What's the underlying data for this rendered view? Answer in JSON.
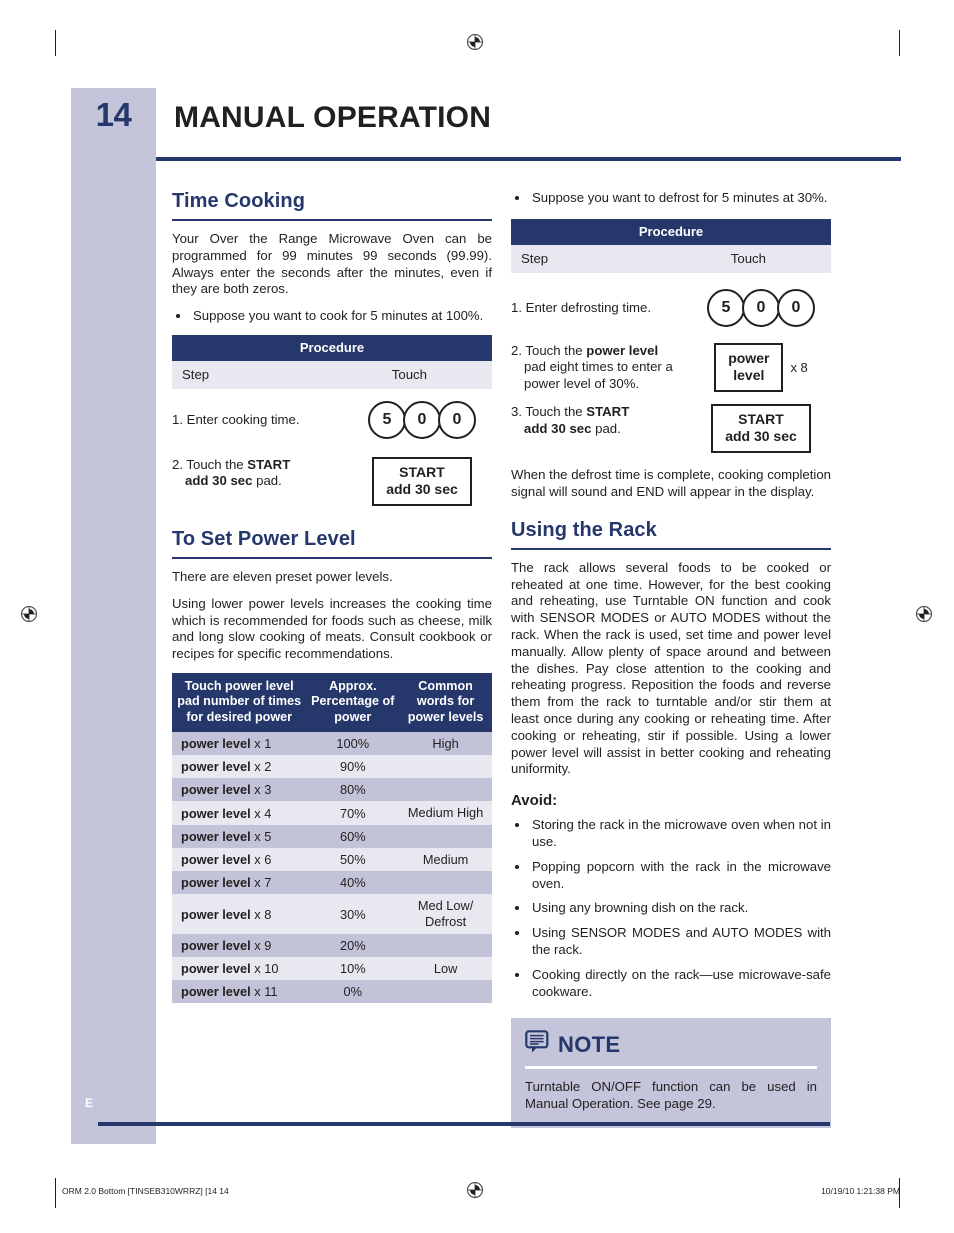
{
  "masthead": {
    "page_number": "14",
    "title": "MANUAL OPERATION"
  },
  "left_column": {
    "time_cooking": {
      "heading": "Time Cooking",
      "intro": "Your Over the Range Microwave Oven can be programmed for 99 minutes 99 seconds (99.99). Always enter the seconds after the minutes, even if they are both zeros.",
      "bullet": "Suppose you want to cook for 5 minutes at 100%.",
      "table": {
        "header": "Procedure",
        "col_step": "Step",
        "col_touch": "Touch",
        "rows": [
          {
            "step_plain": "1. Enter cooking time.",
            "touch_type": "keys",
            "keys": [
              "5",
              "0",
              "0"
            ]
          },
          {
            "step_prefix": "2. Touch the ",
            "step_bold": "START",
            "step_bold2": "add 30 sec",
            "step_suffix": " pad.",
            "touch_type": "pad",
            "pad_line1": "START",
            "pad_line2": "add 30 sec"
          }
        ]
      }
    },
    "power_level": {
      "heading": "To Set Power Level",
      "para1": "There are eleven preset power levels.",
      "para2": "Using lower power levels increases the cooking time which is recommended for foods such as cheese, milk and long slow cooking of meats. Consult cookbook or recipes for specific recommendations.",
      "table": {
        "headers": [
          "Touch power level pad number of times for desired power",
          "Approx. Percentage of power",
          "Common words for power levels"
        ],
        "rows": [
          {
            "pad_bold": "power level",
            "times": "x 1",
            "percent": "100%",
            "word": "High"
          },
          {
            "pad_bold": "power level",
            "times": "x 2",
            "percent": "90%",
            "word": ""
          },
          {
            "pad_bold": "power level",
            "times": "x 3",
            "percent": "80%",
            "word": ""
          },
          {
            "pad_bold": "power level",
            "times": "x 4",
            "percent": "70%",
            "word": "Medium High"
          },
          {
            "pad_bold": "power level",
            "times": "x 5",
            "percent": "60%",
            "word": ""
          },
          {
            "pad_bold": "power level",
            "times": "x 6",
            "percent": "50%",
            "word": "Medium"
          },
          {
            "pad_bold": "power level",
            "times": "x 7",
            "percent": "40%",
            "word": ""
          },
          {
            "pad_bold": "power level",
            "times": "x 8",
            "percent": "30%",
            "word": "Med Low/ Defrost"
          },
          {
            "pad_bold": "power level",
            "times": "x 9",
            "percent": "20%",
            "word": ""
          },
          {
            "pad_bold": "power level",
            "times": "x 10",
            "percent": "10%",
            "word": "Low"
          },
          {
            "pad_bold": "power level",
            "times": "x 11",
            "percent": "0%",
            "word": ""
          }
        ]
      }
    }
  },
  "right_column": {
    "defrost": {
      "bullet": "Suppose you want to defrost for 5 minutes at 30%.",
      "table": {
        "header": "Procedure",
        "col_step": "Step",
        "col_touch": "Touch",
        "rows": [
          {
            "step_plain": "1. Enter defrosting time.",
            "touch_type": "keys",
            "keys": [
              "5",
              "0",
              "0"
            ]
          },
          {
            "step_prefix": "2. Touch the ",
            "step_bold": "power level",
            "step_suffix": " pad eight times to enter a power level of 30%.",
            "touch_type": "pad",
            "pad_line1": "power",
            "pad_line2": "level",
            "multiplier": "x 8"
          },
          {
            "step_prefix": "3. Touch the ",
            "step_bold": "START",
            "step_bold2": "add 30 sec",
            "step_suffix": " pad.",
            "touch_type": "pad",
            "pad_line1": "START",
            "pad_line2": "add 30 sec"
          }
        ]
      },
      "closing": "When the defrost time is complete, cooking completion signal will sound and END will appear in the display."
    },
    "using_the_rack": {
      "heading": "Using the Rack",
      "body": "The rack allows several foods to be cooked or reheated at one time. However, for the best cooking and reheating, use Turntable ON function and cook with SENSOR MODES or AUTO MODES without the rack. When the rack is used, set time and power level manually. Allow plenty of space around and between the dishes. Pay close attention to the cooking and reheating progress. Reposition the foods and reverse them from the rack to turntable and/or stir them at least once during any cooking or reheating time. After cooking or reheating, stir if possible. Using a lower power level will assist in better cooking and reheating uniformity.",
      "avoid_heading": "Avoid:",
      "avoid_items": [
        "Storing the rack in the microwave oven when not in use.",
        "Popping popcorn with the rack in the microwave oven.",
        "Using any browning dish on the rack.",
        "Using SENSOR MODES and AUTO MODES with the rack.",
        "Cooking directly on the rack—use microwave-safe cookware."
      ]
    },
    "note": {
      "icon": "note-document-icon",
      "title": "NOTE",
      "body": "Turntable ON/OFF function can be used in Manual Operation.  See page 29."
    }
  },
  "page_marker": "E",
  "footer": {
    "left": "ORM 2.0 Bottom [TINSEB310WRRZ] [14   14",
    "right": "10/19/10   1:21:38 PM"
  },
  "colors": {
    "brand_blue": "#25376b",
    "lavender_band": "#c4c4da",
    "row_dark": "#c2c2d8",
    "row_light": "#e8e8f0",
    "text": "#231f20"
  }
}
